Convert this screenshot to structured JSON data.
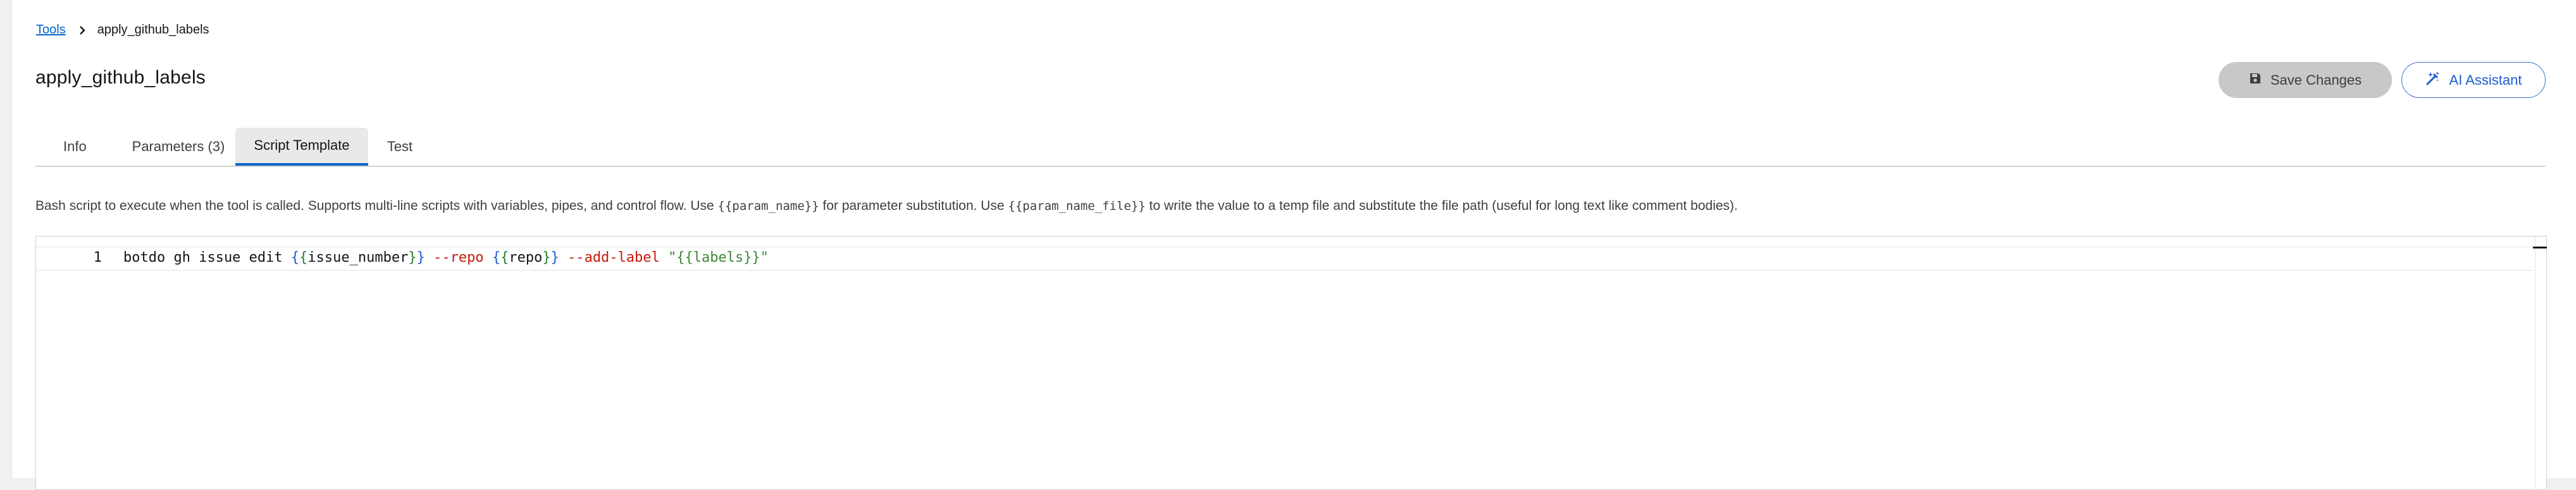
{
  "breadcrumb": {
    "parent_label": "Tools",
    "current_label": "apply_github_labels"
  },
  "page": {
    "title": "apply_github_labels"
  },
  "actions": {
    "save_label": "Save Changes",
    "ai_label": "AI Assistant"
  },
  "tabs": [
    {
      "label": "Info",
      "active": false
    },
    {
      "label": "Parameters (3)",
      "active": false
    },
    {
      "label": "Script Template",
      "active": true
    },
    {
      "label": "Test",
      "active": false
    }
  ],
  "description": {
    "part1": "Bash script to execute when the tool is called. Supports multi-line scripts with variables, pipes, and control flow. Use ",
    "code1": "{{param_name}}",
    "part2": " for parameter substitution. Use ",
    "code2": "{{param_name_file}}",
    "part3": " to write the value to a temp file and substitute the file path (useful for long text like comment bodies)."
  },
  "editor": {
    "line_number": "1",
    "tokens": {
      "t1": "botdo gh issue edit ",
      "t2": "{",
      "t3": "{",
      "t4": "issue_number",
      "t5": "}",
      "t6": "}",
      "t7": " ",
      "t8": "--repo",
      "t9": " ",
      "t10": "{",
      "t11": "{",
      "t12": "repo",
      "t13": "}",
      "t14": "}",
      "t15": " ",
      "t16": "--add-label",
      "t17": " ",
      "t18": "\"{{labels}}\""
    }
  },
  "colors": {
    "link": "#0066cc",
    "accent": "#1f5bd1",
    "save_button_bg": "#c8c8c8",
    "active_tab_bg": "#e9e9e9",
    "code_flag": "#c9190b",
    "code_string": "#3e8635"
  },
  "icons": {
    "breadcrumb_separator": "chevron-right-icon",
    "save": "floppy-disk-icon",
    "ai": "magic-wand-icon"
  }
}
